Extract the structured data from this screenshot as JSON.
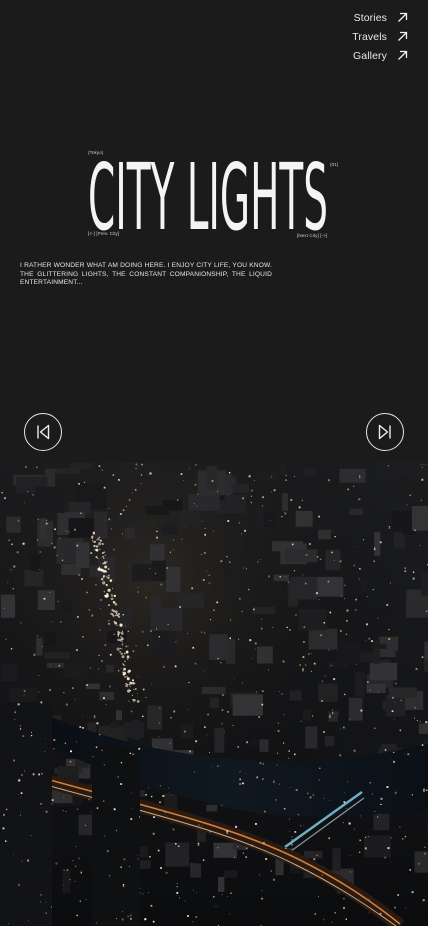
{
  "nav": {
    "items": [
      {
        "label": "Stories",
        "icon": "arrow-up-right-icon"
      },
      {
        "label": "Travels",
        "icon": "arrow-up-right-icon"
      },
      {
        "label": "Gallery",
        "icon": "arrow-up-right-icon"
      }
    ]
  },
  "hero": {
    "location": "(Tokyo)",
    "title": "CITY LIGHTS",
    "index": "(01)",
    "prev_city": "[<-] [Prev. City]",
    "next_city": "[Next City] [->]"
  },
  "description": "I rather wonder what am doing here. I enjoy city life, you know. The glittering lights, the constant companionship, the liquid entertainment...",
  "controls": {
    "prev_icon": "skip-previous-icon",
    "next_icon": "skip-next-icon"
  },
  "photo": {
    "subject": "night-city-aerial"
  },
  "colors": {
    "background": "#1b1b1b",
    "text": "#f2f2f2"
  }
}
